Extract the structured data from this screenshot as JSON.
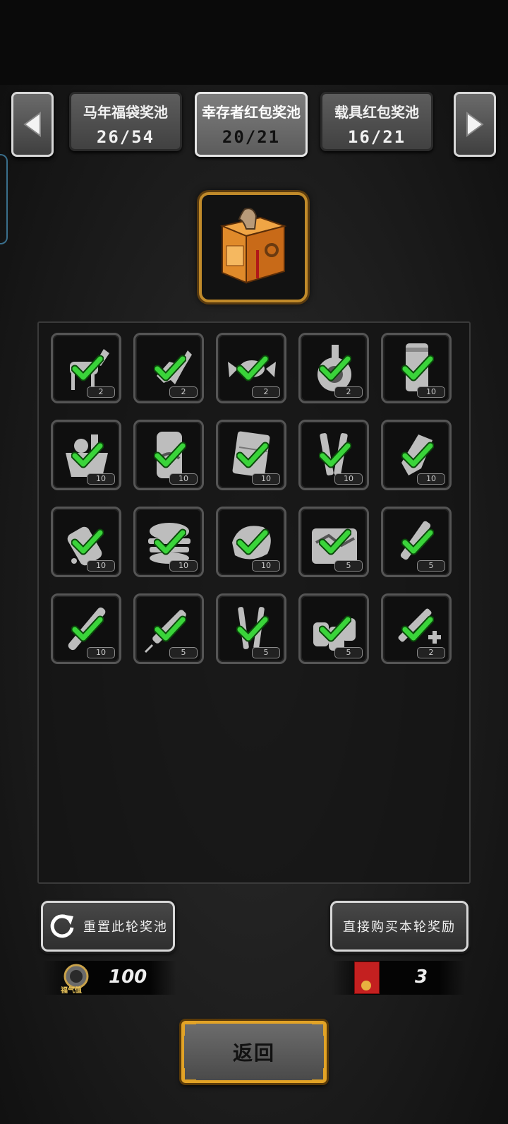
{
  "tabs": [
    {
      "name": "马年福袋奖池",
      "count": "26/54",
      "active": false
    },
    {
      "name": "幸存者红包奖池",
      "count": "20/21",
      "active": true
    },
    {
      "name": "载具红包奖池",
      "count": "16/21",
      "active": false
    }
  ],
  "items": [
    {
      "icon": "horse-statue-icon",
      "qty": "2"
    },
    {
      "icon": "galloping-horse-icon",
      "qty": "2"
    },
    {
      "icon": "candy-icon",
      "qty": "2"
    },
    {
      "icon": "flask-coil-icon",
      "qty": "2"
    },
    {
      "icon": "coffee-can-icon",
      "qty": "10"
    },
    {
      "icon": "food-basket-icon",
      "qty": "10"
    },
    {
      "icon": "soda-can-icon",
      "qty": "10"
    },
    {
      "icon": "chocolate-bar-icon",
      "qty": "10"
    },
    {
      "icon": "sticks-icon",
      "qty": "10"
    },
    {
      "icon": "bread-roll-icon",
      "qty": "10"
    },
    {
      "icon": "sauce-bottle-icon",
      "qty": "10"
    },
    {
      "icon": "burger-icon",
      "qty": "10"
    },
    {
      "icon": "meat-chunk-icon",
      "qty": "10"
    },
    {
      "icon": "first-aid-bag-icon",
      "qty": "5"
    },
    {
      "icon": "injector-pen-icon",
      "qty": "5"
    },
    {
      "icon": "glow-stick-icon",
      "qty": "10"
    },
    {
      "icon": "syringe-icon",
      "qty": "5"
    },
    {
      "icon": "vials-icon",
      "qty": "5"
    },
    {
      "icon": "pill-bottles-icon",
      "qty": "5"
    },
    {
      "icon": "medical-syringe-icon",
      "qty": "2"
    }
  ],
  "buttons": {
    "reset_label": "重置此轮奖池",
    "buy_label": "直接购买本轮奖励",
    "back_label": "返回"
  },
  "resources": {
    "luck_label": "福气值",
    "luck_value": "100",
    "envelope_value": "3"
  },
  "colors": {
    "check": "#3ad43a",
    "chest_border": "#c08a2a",
    "back_border": "#e2a326"
  }
}
